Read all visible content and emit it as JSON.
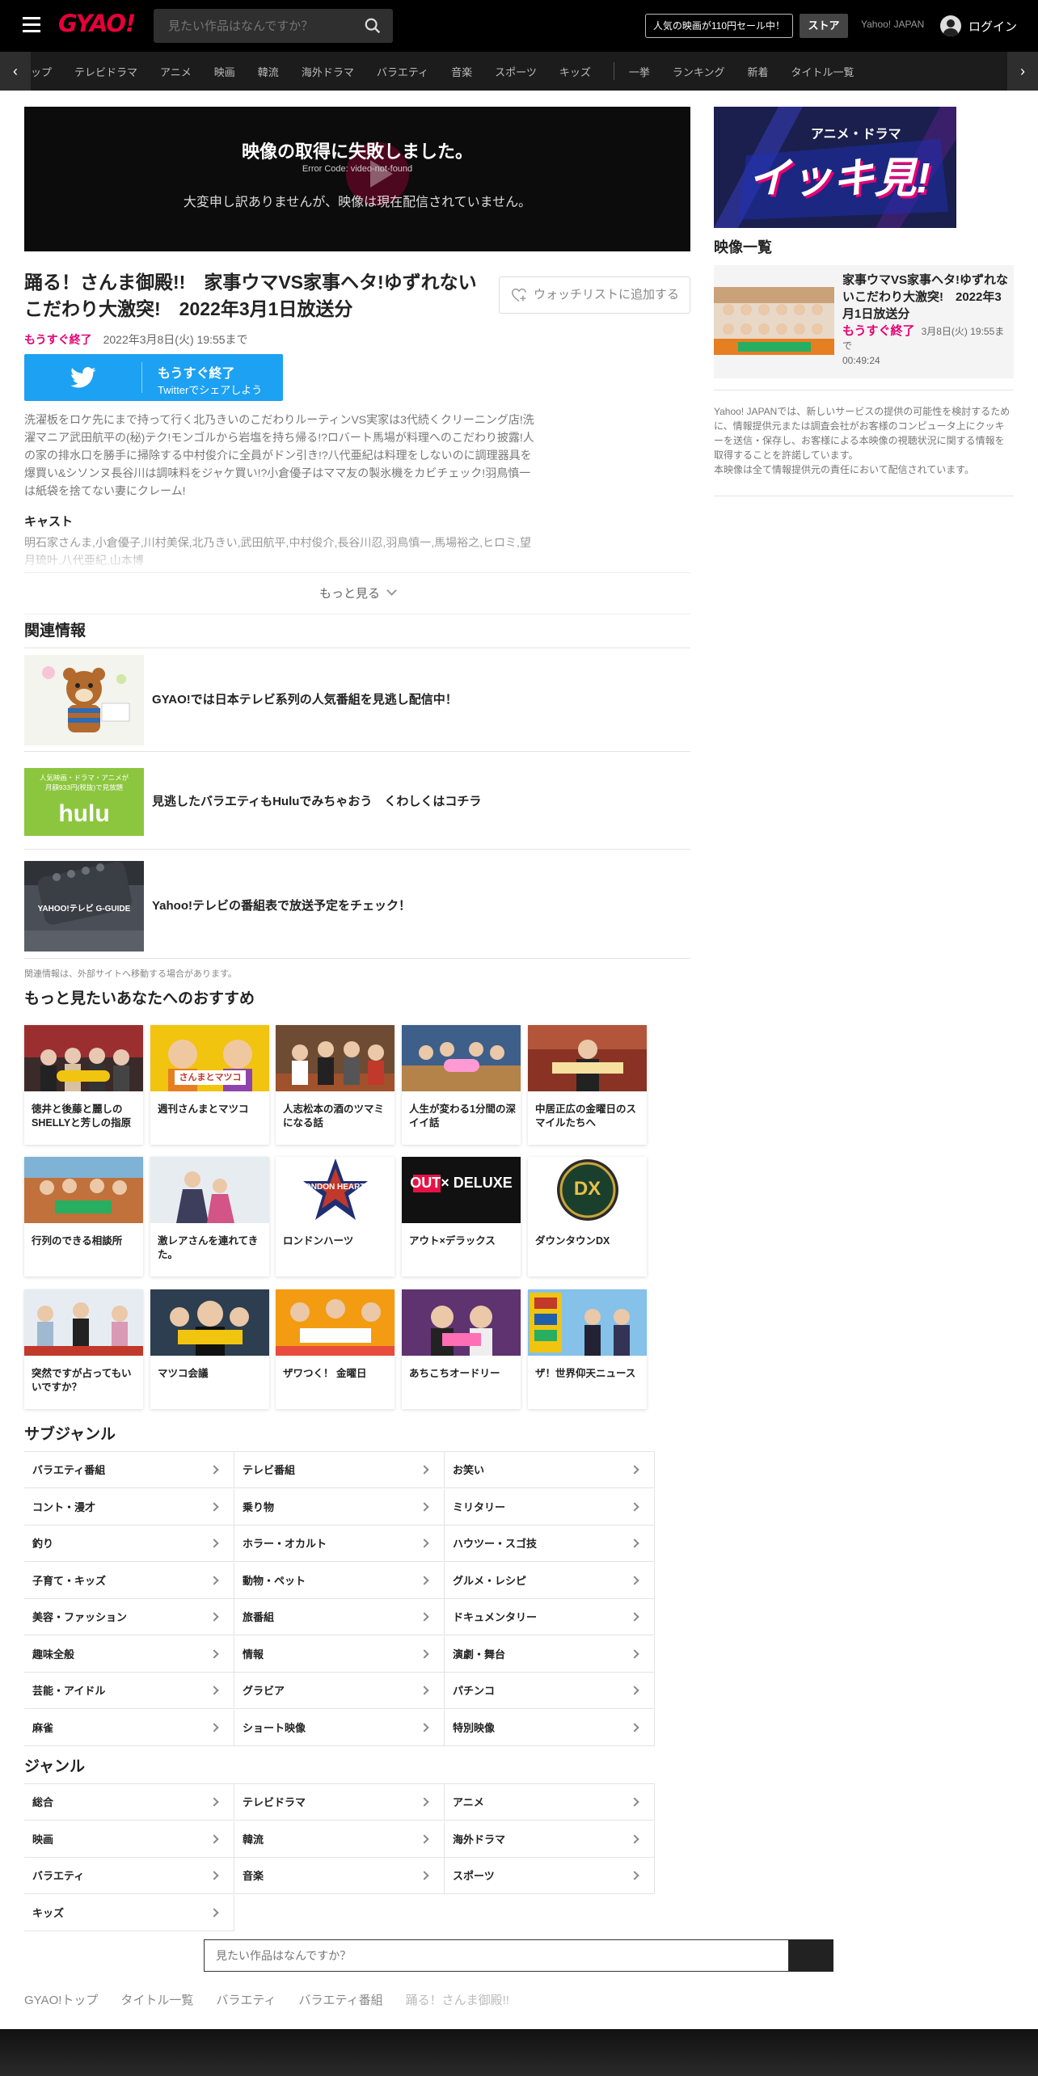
{
  "header": {
    "logo": "GYAO!",
    "search_placeholder": "見たい作品はなんですか？",
    "sale_label": "人気の映画が110円セール中！",
    "store_label": "ストア",
    "yahoo_label": "Yahoo! JAPAN",
    "login_label": "ログイン"
  },
  "nav": {
    "items": [
      "ップ",
      "テレビドラマ",
      "アニメ",
      "映画",
      "韓流",
      "海外ドラマ",
      "バラエティ",
      "音楽",
      "スポーツ",
      "キッズ",
      "一挙",
      "ランキング",
      "新着",
      "タイトル一覧"
    ],
    "left_arrow": "‹",
    "right_arrow": "›"
  },
  "player": {
    "error_title": "映像の取得に失敗しました。",
    "error_code": "Error Code: video-not-found",
    "error_message": "大変申し訳ありませんが、映像は現在配信されていません。"
  },
  "episode": {
    "title": "踊る！さんま御殿!!　家事ウマVS家事ヘタ!ゆずれないこだわり大激突!　2022年3月1日放送分",
    "watchlist_label": "ウォッチリストに追加する",
    "soon_label": "もうすぐ終了",
    "until_label": "2022年3月8日(火) 19:55まで",
    "twitter_line1": "もうすぐ終了",
    "twitter_line2": "Twitterでシェアしよう",
    "description": "洗濯板をロケ先にまで持って行く北乃きいのこだわりルーティンVS実家は3代続くクリーニング店!洗濯マニア武田航平の(秘)テク!モンゴルから岩塩を持ち帰る!?ロバート馬場が料理へのこだわり披露!人の家の排水口を勝手に掃除する中村俊介に全員がドン引き!?八代亜紀は料理をしないのに調理器具を爆買い&シソンヌ長谷川は調味料をジャケ買い!?小倉優子はママ友の製氷機をカビチェック!羽鳥慎一は紙袋を捨てない妻にクレーム!",
    "cast_heading": "キャスト",
    "cast": "明石家さんま,小倉優子,川村美保,北乃きい,武田航平,中村俊介,長谷川忍,羽鳥慎一,馬場裕之,ヒロミ,望月琉叶,八代亜紀,山本博",
    "more_label": "もっと見る"
  },
  "related": {
    "heading": "関連情報",
    "items": [
      {
        "text": "GYAO!では日本テレビ系列の人気番組を見逃し配信中！"
      },
      {
        "text": "見逃したバラエティもHuluでみちゃおう　くわしくはコチラ",
        "thumb_text": "人気映画・ドラマ・アニメが\n月額933円(税抜)で見放題",
        "thumb_logo": "hulu"
      },
      {
        "text": "Yahoo!テレビの番組表で放送予定をチェック！",
        "thumb_text": "YAHOO!テレビ  G-GUIDE"
      }
    ],
    "note": "関連情報は、外部サイトへ移動する場合があります。"
  },
  "recommend": {
    "heading": "もっと見たいあなたへのおすすめ",
    "items": [
      {
        "title": "徳井と後藤と麗しのSHELLYと芳しの指原",
        "color": "#c0392b"
      },
      {
        "title": "週刊さんまとマツコ",
        "color": "#f1c40f"
      },
      {
        "title": "人志松本の酒のツマミになる話",
        "color": "#7f5c3c"
      },
      {
        "title": "人生が変わる1分間の深イイ話",
        "color": "#5b7aa6"
      },
      {
        "title": "中居正広の金曜日のスマイルたちへ",
        "color": "#8a3324"
      },
      {
        "title": "行列のできる相談所",
        "color": "#c1713b"
      },
      {
        "title": "激レアさんを連れてきた。",
        "color": "#dce3ea"
      },
      {
        "title": "ロンドンハーツ",
        "color": "#ffffff"
      },
      {
        "title": "アウト×デラックス",
        "color": "#111111"
      },
      {
        "title": "ダウンタウンDX",
        "color": "#ffffff"
      },
      {
        "title": "突然ですが占ってもいいですか？",
        "color": "#a7b8c9"
      },
      {
        "title": "マツコ会議",
        "color": "#2c3e50"
      },
      {
        "title": "ザワつく！ 金曜日",
        "color": "#f39c12"
      },
      {
        "title": "あちこちオードリー",
        "color": "#5e3370"
      },
      {
        "title": "ザ！世界仰天ニュース",
        "color": "#2e86c1"
      }
    ],
    "thumb_labels": {
      "london": "LONDON HEARTS",
      "out": "OUT× DELUXE",
      "dx": "DX",
      "sanma": "さんまとマツコ"
    }
  },
  "subgenre": {
    "heading": "サブジャンル",
    "items": [
      "バラエティ番組",
      "テレビ番組",
      "お笑い",
      "コント・漫才",
      "乗り物",
      "ミリタリー",
      "釣り",
      "ホラー・オカルト",
      "ハウツー・スゴ技",
      "子育て・キッズ",
      "動物・ペット",
      "グルメ・レシピ",
      "美容・ファッション",
      "旅番組",
      "ドキュメンタリー",
      "趣味全般",
      "情報",
      "演劇・舞台",
      "芸能・アイドル",
      "グラビア",
      "パチンコ",
      "麻雀",
      "ショート映像",
      "特別映像"
    ]
  },
  "genre": {
    "heading": "ジャンル",
    "items": [
      "総合",
      "テレビドラマ",
      "アニメ",
      "映画",
      "韓流",
      "海外ドラマ",
      "バラエティ",
      "音楽",
      "スポーツ",
      "キッズ"
    ]
  },
  "bottom_search": {
    "placeholder": "見たい作品はなんですか？"
  },
  "breadcrumb": [
    "GYAO!トップ",
    "タイトル一覧",
    "バラエティ",
    "バラエティ番組",
    "踊る！さんま御殿!!"
  ],
  "right": {
    "banner_small": "アニメ・ドラマ",
    "banner_big": "イッキ見!",
    "video_list_heading": "映像一覧",
    "card_title": "家事ウマVS家事ヘタ!ゆずれないこだわり大激突!　2022年3月1日放送分",
    "card_soon": "もうすぐ終了",
    "card_until": "3月8日(火) 19:55まで",
    "card_duration": "00:49:24",
    "notice": "Yahoo! JAPANでは、新しいサービスの提供の可能性を検討するために、情報提供元または調査会社がお客様のコンピュータ上にクッキーを送信・保存し、お客様による本映像の視聴状況に関する情報を取得することを許諾しています。\n本映像は全て情報提供元の責任において配信されています。"
  },
  "colors": {
    "accent": "#e60039",
    "soon": "#e60073",
    "twitter": "#1da1f2"
  }
}
